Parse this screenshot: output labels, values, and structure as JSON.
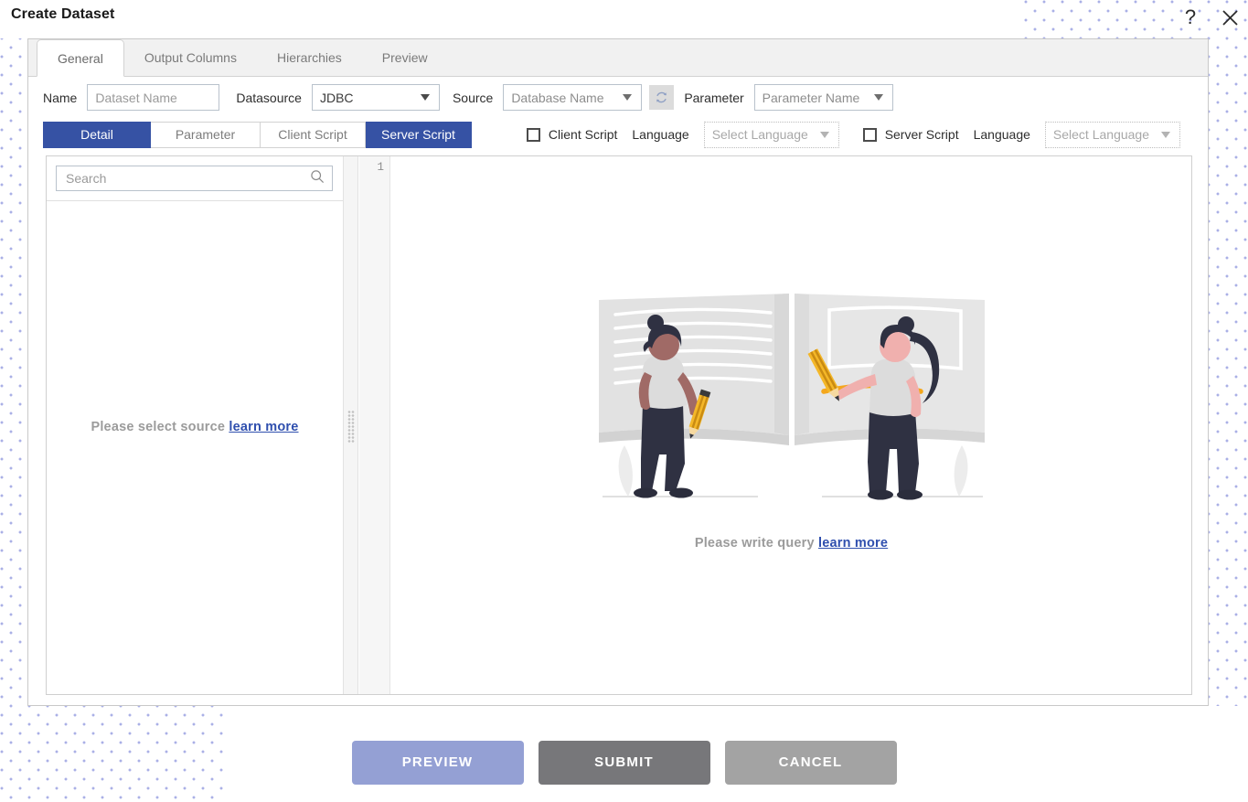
{
  "window": {
    "title": "Create Dataset",
    "help_icon": "question-mark-icon",
    "close_icon": "close-x-icon"
  },
  "tabs": [
    {
      "label": "General",
      "active": true
    },
    {
      "label": "Output Columns",
      "active": false
    },
    {
      "label": "Hierarchies",
      "active": false
    },
    {
      "label": "Preview",
      "active": false
    }
  ],
  "form": {
    "name_label": "Name",
    "name_value": "",
    "name_placeholder": "Dataset Name",
    "datasource_label": "Datasource",
    "datasource_value": "JDBC",
    "source_label": "Source",
    "source_value": "Database Name",
    "refresh_icon": "refresh-icon",
    "parameter_label": "Parameter",
    "parameter_value": "Parameter Name"
  },
  "subtabs": [
    {
      "label": "Detail",
      "active": true
    },
    {
      "label": "Parameter",
      "active": false
    },
    {
      "label": "Client Script",
      "active": false
    },
    {
      "label": "Server Script",
      "active": true
    }
  ],
  "script_options": {
    "client_script_label": "Client Script",
    "client_script_checked": false,
    "client_language_label": "Language",
    "client_language_value": "Select Language",
    "server_script_label": "Server Script",
    "server_script_checked": false,
    "server_language_label": "Language",
    "server_language_value": "Select Language"
  },
  "left_pane": {
    "search_value": "",
    "search_placeholder": "Search",
    "search_icon": "search-icon",
    "empty_text": "Please select source",
    "empty_link": "learn more"
  },
  "editor": {
    "line_number": "1",
    "content": "",
    "empty_text": "Please write query",
    "empty_link": "learn more",
    "illustration": "two-people-open-book-illustration"
  },
  "footer": {
    "preview_label": "PREVIEW",
    "submit_label": "SUBMIT",
    "cancel_label": "CANCEL"
  },
  "colors": {
    "accent_blue": "#3652a4",
    "preview_button": "#94a0d4",
    "submit_button": "#77777a",
    "cancel_button": "#a3a3a3",
    "link_blue": "#2f4fae",
    "dot_pattern": "#aab0e6"
  }
}
